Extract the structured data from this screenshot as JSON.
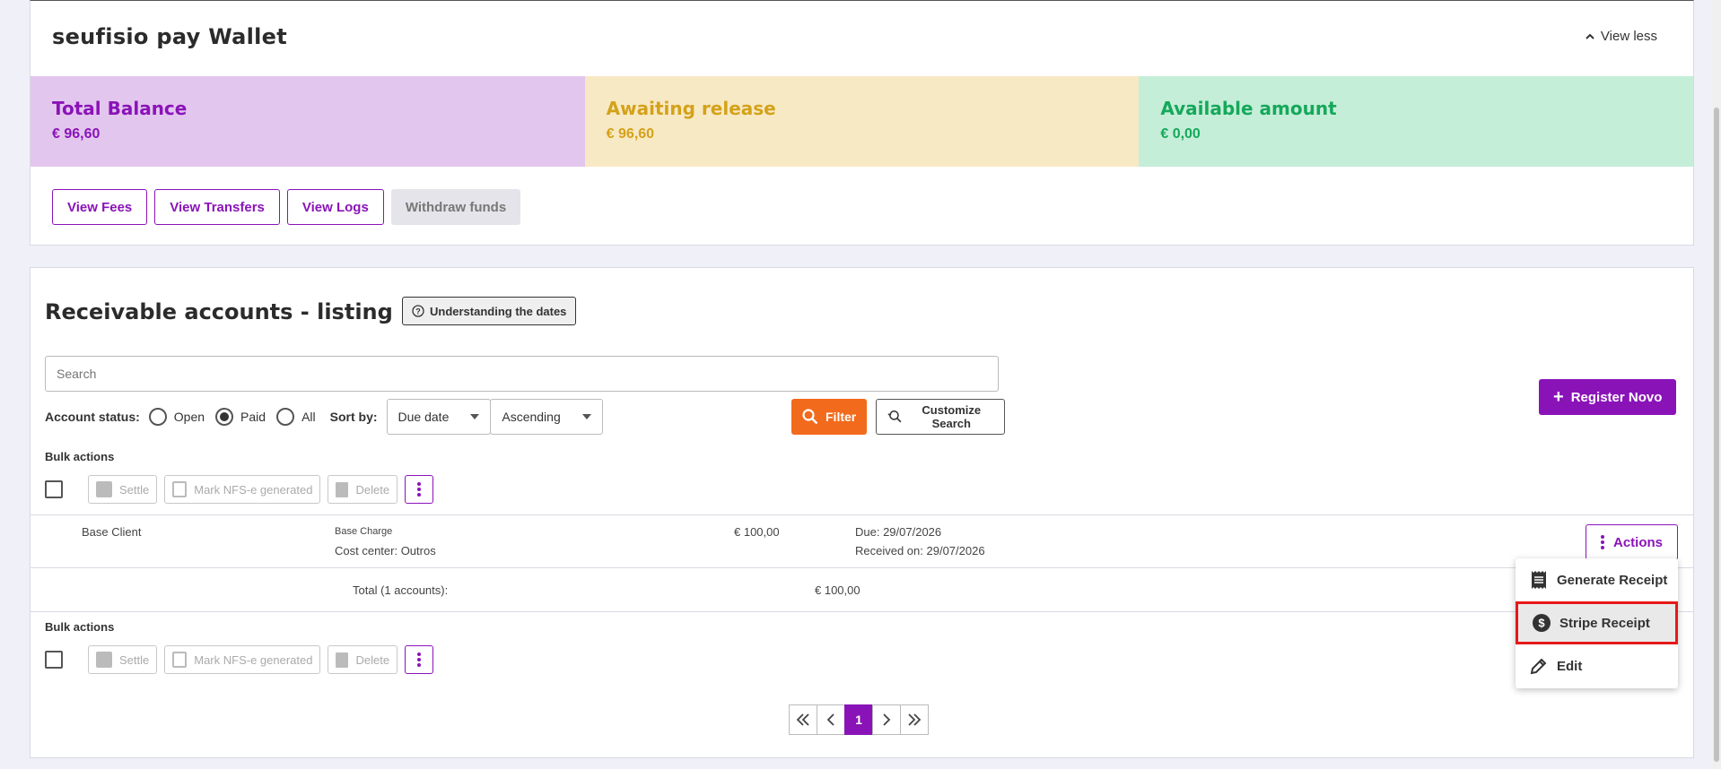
{
  "wallet": {
    "title": "seufisio pay Wallet",
    "view_less": "View less",
    "balances": [
      {
        "label": "Total Balance",
        "value": "€ 96,60"
      },
      {
        "label": "Awaiting release",
        "value": "€ 96,60"
      },
      {
        "label": "Available amount",
        "value": "€ 0,00"
      }
    ],
    "buttons": {
      "fees": "View Fees",
      "transfers": "View Transfers",
      "logs": "View Logs",
      "withdraw": "Withdraw funds"
    }
  },
  "receivable": {
    "title": "Receivable accounts - listing",
    "understanding": "Understanding the dates",
    "search_placeholder": "Search",
    "register": "Register Novo",
    "account_status_label": "Account status:",
    "status_options": [
      "Open",
      "Paid",
      "All"
    ],
    "selected_status": "Paid",
    "sort_by_label": "Sort by:",
    "sort_field": "Due date",
    "sort_order": "Ascending",
    "filter": "Filter",
    "customize": "Customize Search",
    "bulk_label": "Bulk actions",
    "bulk": {
      "settle": "Settle",
      "nfse": "Mark NFS-e generated",
      "delete": "Delete"
    },
    "row": {
      "client": "Base Client",
      "charge": "Base Charge",
      "cost_center": "Cost center: Outros",
      "amount": "€ 100,00",
      "due": "Due: 29/07/2026",
      "received": "Received on: 29/07/2026",
      "actions": "Actions"
    },
    "total_label": "Total (1 accounts):",
    "total_value": "€ 100,00",
    "menu": {
      "generate": "Generate Receipt",
      "stripe": "Stripe Receipt",
      "edit": "Edit"
    },
    "pagination": {
      "current": "1"
    }
  },
  "colors": {
    "accent": "#8a13b8",
    "filter": "#f26a1b",
    "highlight": "#e61919"
  }
}
